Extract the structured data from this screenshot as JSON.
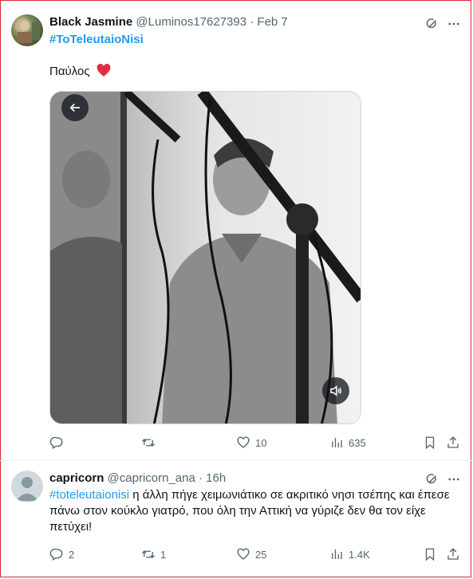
{
  "tweet1": {
    "display_name": "Black Jasmine",
    "handle": "@Luminos17627393",
    "separator": "·",
    "date": "Feb 7",
    "hashtag": "#ToTeleutaioNisi",
    "body": "Παύλος",
    "emoji": "❤️",
    "actions": {
      "reply": "",
      "retweet": "",
      "like": "10",
      "views": "635"
    }
  },
  "tweet2": {
    "display_name": "capricorn",
    "handle": "@capricorn_ana",
    "separator": "·",
    "date": "16h",
    "hashtag": "#toteleutaionisi",
    "body": " η άλλη πήγε χειμωνιάτικο σε ακριτικό νησι τσέπης και έπεσε πάνω στον κούκλο γιατρό, που όλη την Αττική να γύριζε δεν θα τον είχε πετύχει!",
    "actions": {
      "reply": "2",
      "retweet": "1",
      "like": "25",
      "views": "1.4K"
    }
  },
  "colors": {
    "accent": "#1d9bf0",
    "heart": "#f91880",
    "frame": "#d7282f",
    "muted": "#536471"
  },
  "icons": [
    "grok-icon",
    "more-icon",
    "back-arrow-icon",
    "volume-icon",
    "reply-icon",
    "retweet-icon",
    "like-icon",
    "views-icon",
    "bookmark-icon",
    "share-icon"
  ]
}
